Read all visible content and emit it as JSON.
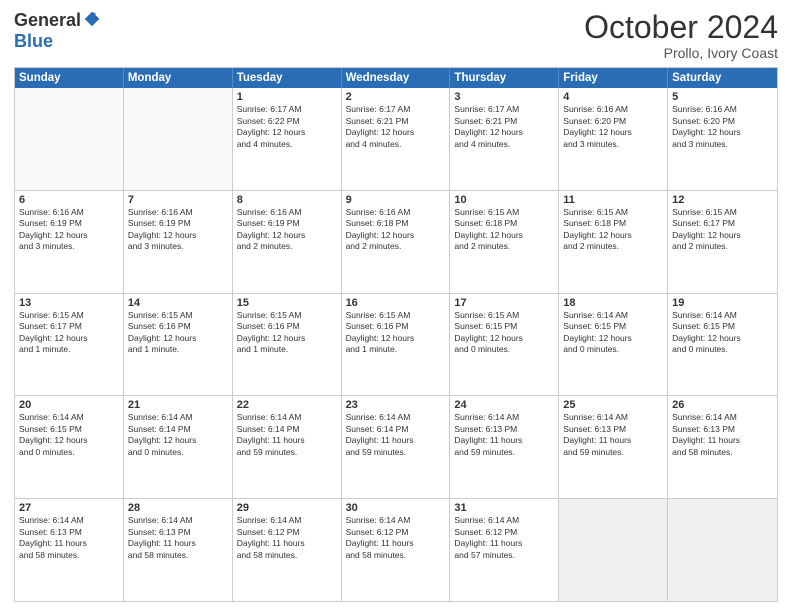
{
  "logo": {
    "general": "General",
    "blue": "Blue"
  },
  "header": {
    "month": "October 2024",
    "location": "Prollo, Ivory Coast"
  },
  "weekdays": [
    "Sunday",
    "Monday",
    "Tuesday",
    "Wednesday",
    "Thursday",
    "Friday",
    "Saturday"
  ],
  "rows": [
    [
      {
        "day": "",
        "text": "",
        "empty": true
      },
      {
        "day": "",
        "text": "",
        "empty": true
      },
      {
        "day": "1",
        "text": "Sunrise: 6:17 AM\nSunset: 6:22 PM\nDaylight: 12 hours\nand 4 minutes."
      },
      {
        "day": "2",
        "text": "Sunrise: 6:17 AM\nSunset: 6:21 PM\nDaylight: 12 hours\nand 4 minutes."
      },
      {
        "day": "3",
        "text": "Sunrise: 6:17 AM\nSunset: 6:21 PM\nDaylight: 12 hours\nand 4 minutes."
      },
      {
        "day": "4",
        "text": "Sunrise: 6:16 AM\nSunset: 6:20 PM\nDaylight: 12 hours\nand 3 minutes."
      },
      {
        "day": "5",
        "text": "Sunrise: 6:16 AM\nSunset: 6:20 PM\nDaylight: 12 hours\nand 3 minutes."
      }
    ],
    [
      {
        "day": "6",
        "text": "Sunrise: 6:16 AM\nSunset: 6:19 PM\nDaylight: 12 hours\nand 3 minutes."
      },
      {
        "day": "7",
        "text": "Sunrise: 6:16 AM\nSunset: 6:19 PM\nDaylight: 12 hours\nand 3 minutes."
      },
      {
        "day": "8",
        "text": "Sunrise: 6:16 AM\nSunset: 6:19 PM\nDaylight: 12 hours\nand 2 minutes."
      },
      {
        "day": "9",
        "text": "Sunrise: 6:16 AM\nSunset: 6:18 PM\nDaylight: 12 hours\nand 2 minutes."
      },
      {
        "day": "10",
        "text": "Sunrise: 6:15 AM\nSunset: 6:18 PM\nDaylight: 12 hours\nand 2 minutes."
      },
      {
        "day": "11",
        "text": "Sunrise: 6:15 AM\nSunset: 6:18 PM\nDaylight: 12 hours\nand 2 minutes."
      },
      {
        "day": "12",
        "text": "Sunrise: 6:15 AM\nSunset: 6:17 PM\nDaylight: 12 hours\nand 2 minutes."
      }
    ],
    [
      {
        "day": "13",
        "text": "Sunrise: 6:15 AM\nSunset: 6:17 PM\nDaylight: 12 hours\nand 1 minute."
      },
      {
        "day": "14",
        "text": "Sunrise: 6:15 AM\nSunset: 6:16 PM\nDaylight: 12 hours\nand 1 minute."
      },
      {
        "day": "15",
        "text": "Sunrise: 6:15 AM\nSunset: 6:16 PM\nDaylight: 12 hours\nand 1 minute."
      },
      {
        "day": "16",
        "text": "Sunrise: 6:15 AM\nSunset: 6:16 PM\nDaylight: 12 hours\nand 1 minute."
      },
      {
        "day": "17",
        "text": "Sunrise: 6:15 AM\nSunset: 6:15 PM\nDaylight: 12 hours\nand 0 minutes."
      },
      {
        "day": "18",
        "text": "Sunrise: 6:14 AM\nSunset: 6:15 PM\nDaylight: 12 hours\nand 0 minutes."
      },
      {
        "day": "19",
        "text": "Sunrise: 6:14 AM\nSunset: 6:15 PM\nDaylight: 12 hours\nand 0 minutes."
      }
    ],
    [
      {
        "day": "20",
        "text": "Sunrise: 6:14 AM\nSunset: 6:15 PM\nDaylight: 12 hours\nand 0 minutes."
      },
      {
        "day": "21",
        "text": "Sunrise: 6:14 AM\nSunset: 6:14 PM\nDaylight: 12 hours\nand 0 minutes."
      },
      {
        "day": "22",
        "text": "Sunrise: 6:14 AM\nSunset: 6:14 PM\nDaylight: 11 hours\nand 59 minutes."
      },
      {
        "day": "23",
        "text": "Sunrise: 6:14 AM\nSunset: 6:14 PM\nDaylight: 11 hours\nand 59 minutes."
      },
      {
        "day": "24",
        "text": "Sunrise: 6:14 AM\nSunset: 6:13 PM\nDaylight: 11 hours\nand 59 minutes."
      },
      {
        "day": "25",
        "text": "Sunrise: 6:14 AM\nSunset: 6:13 PM\nDaylight: 11 hours\nand 59 minutes."
      },
      {
        "day": "26",
        "text": "Sunrise: 6:14 AM\nSunset: 6:13 PM\nDaylight: 11 hours\nand 58 minutes."
      }
    ],
    [
      {
        "day": "27",
        "text": "Sunrise: 6:14 AM\nSunset: 6:13 PM\nDaylight: 11 hours\nand 58 minutes."
      },
      {
        "day": "28",
        "text": "Sunrise: 6:14 AM\nSunset: 6:13 PM\nDaylight: 11 hours\nand 58 minutes."
      },
      {
        "day": "29",
        "text": "Sunrise: 6:14 AM\nSunset: 6:12 PM\nDaylight: 11 hours\nand 58 minutes."
      },
      {
        "day": "30",
        "text": "Sunrise: 6:14 AM\nSunset: 6:12 PM\nDaylight: 11 hours\nand 58 minutes."
      },
      {
        "day": "31",
        "text": "Sunrise: 6:14 AM\nSunset: 6:12 PM\nDaylight: 11 hours\nand 57 minutes."
      },
      {
        "day": "",
        "text": "",
        "empty": true,
        "shaded": true
      },
      {
        "day": "",
        "text": "",
        "empty": true,
        "shaded": true
      }
    ]
  ]
}
